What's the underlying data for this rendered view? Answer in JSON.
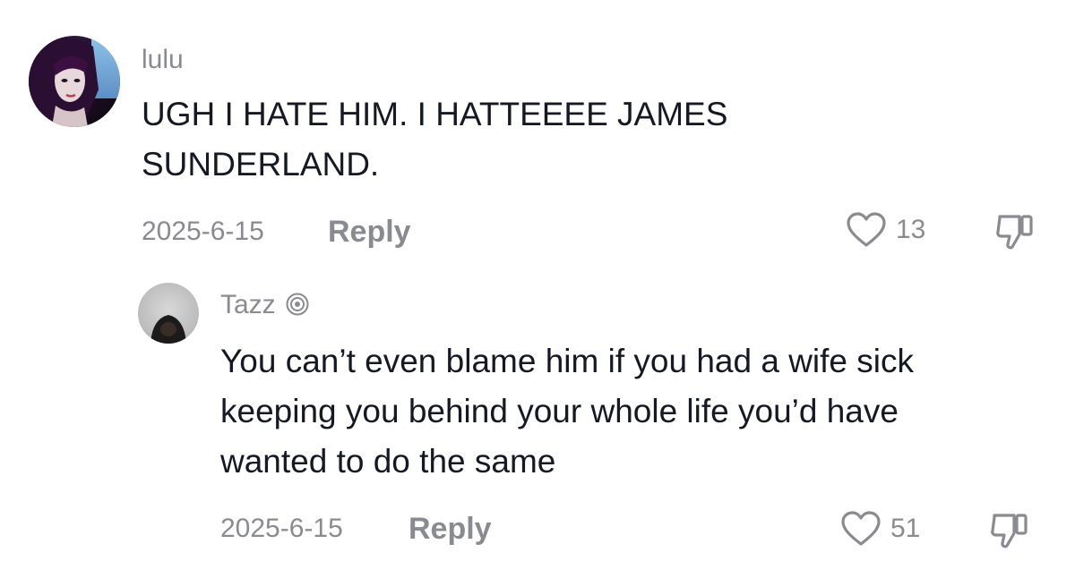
{
  "comments": [
    {
      "username": "lulu",
      "text_lines": [
        "UGH I HATE HIM. I HATTEEEE JAMES",
        "SUNDERLAND."
      ],
      "date": "2025-6-15",
      "reply_label": "Reply",
      "likes": "13",
      "icons": {
        "like": "heart-outline-icon",
        "dislike": "thumbs-down-icon"
      }
    },
    {
      "username": "Tazz",
      "badge_icon": "concentric-circle-icon",
      "text_lines": [
        "You can’t even blame him if you had a wife sick",
        "keeping you behind your whole life you’d have",
        "wanted to do the same"
      ],
      "date": "2025-6-15",
      "reply_label": "Reply",
      "likes": "51",
      "icons": {
        "like": "heart-outline-icon",
        "dislike": "thumbs-down-icon"
      }
    }
  ]
}
